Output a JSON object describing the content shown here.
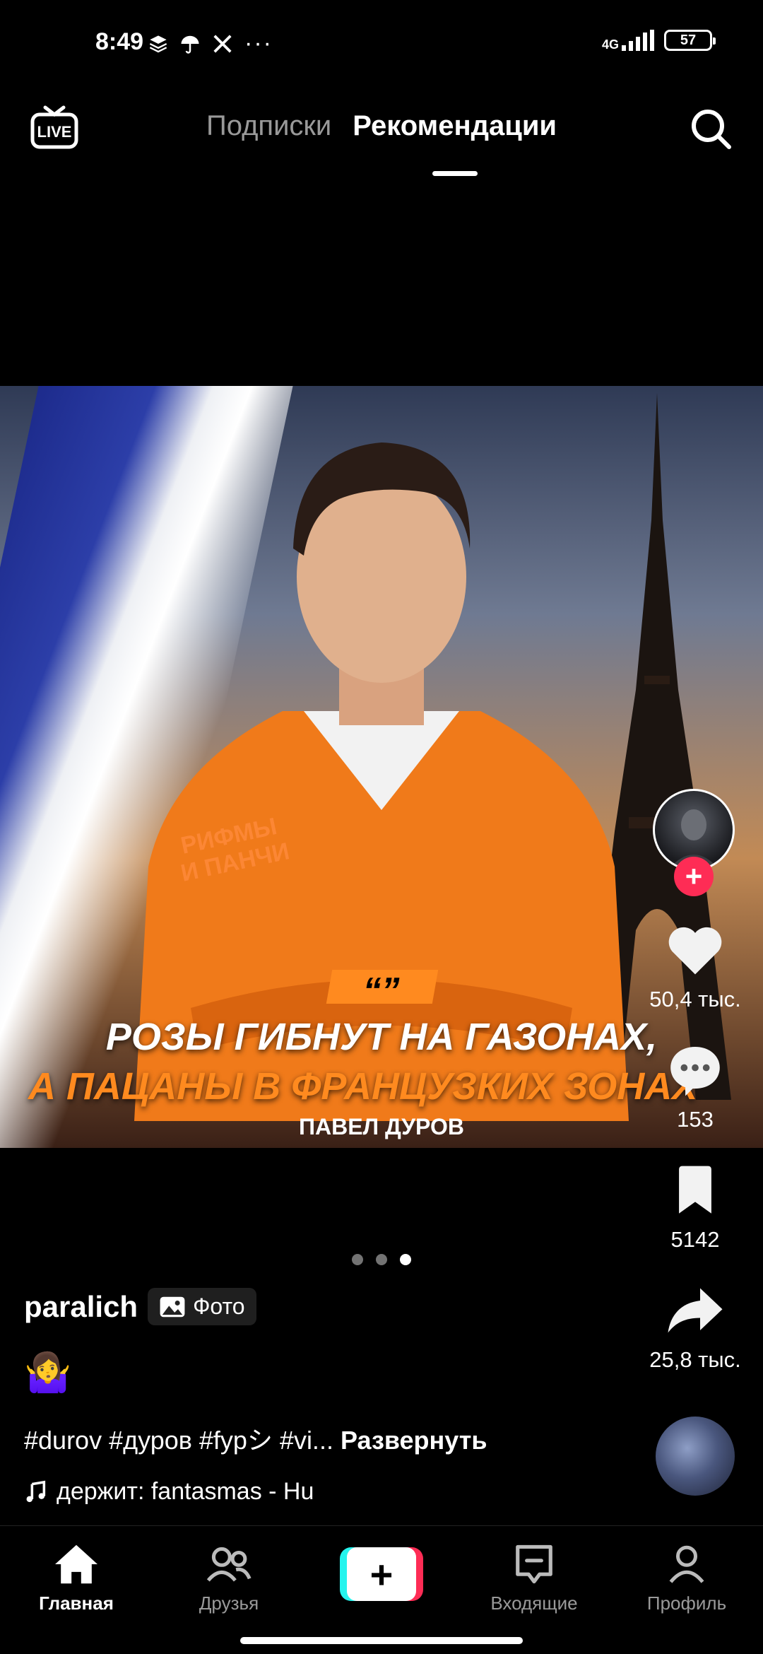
{
  "status_bar": {
    "time": "8:49",
    "network": "4G",
    "battery": "57"
  },
  "top_nav": {
    "live_label": "LIVE",
    "tabs": [
      {
        "label": "Подписки",
        "active": false
      },
      {
        "label": "Рекомендации",
        "active": true
      }
    ]
  },
  "post": {
    "image_text": {
      "quote_mark": "“”",
      "line1": "РОЗЫ ГИБНУТ НА ГАЗОНАХ,",
      "line2": "А ПАЦАНЫ В ФРАНЦУЗКИХ ЗОНАХ",
      "author": "ПАВЕЛ ДУРОВ",
      "brand_line1": "РИФМЫ",
      "brand_line2": "И ПАНЧИ"
    },
    "carousel": {
      "count": 3,
      "active_index": 2
    },
    "username": "paralich",
    "type_label": "Фото",
    "emoji": "🤷‍♀️",
    "hashtags": "#durov #дуров #fypシ #vi...",
    "expand_label": "Развернуть",
    "music": "держит: fantasmas - Hu"
  },
  "actions": {
    "likes": "50,4 тыс.",
    "comments": "153",
    "saves": "5142",
    "shares": "25,8 тыс."
  },
  "bottom_nav": {
    "items": [
      {
        "label": "Главная",
        "active": true
      },
      {
        "label": "Друзья",
        "active": false
      },
      {
        "label": "",
        "active": false
      },
      {
        "label": "Входящие",
        "active": false
      },
      {
        "label": "Профиль",
        "active": false
      }
    ]
  },
  "colors": {
    "accent_red": "#fe2c55",
    "accent_cyan": "#25f4ee",
    "caption_orange": "#ff8a1f"
  }
}
